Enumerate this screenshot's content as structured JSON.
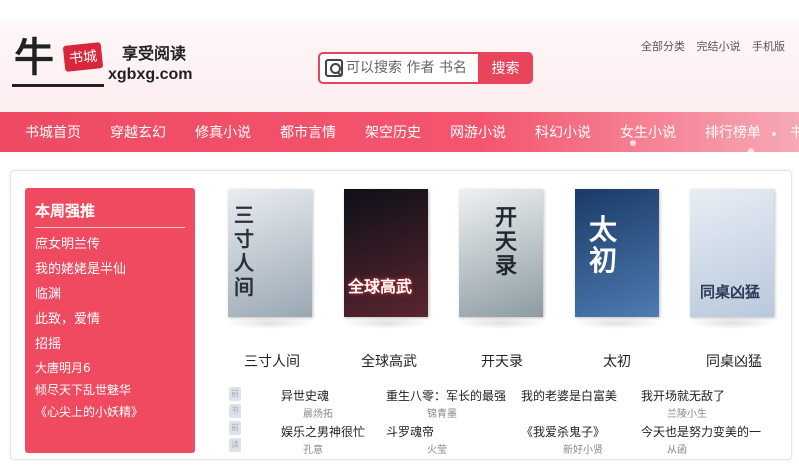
{
  "logo": {
    "char": "牛",
    "box": "书城",
    "slogan": "享受阅读",
    "domain": "xgbxg.com"
  },
  "search": {
    "placeholder": "可以搜索 作者 书名",
    "button": "搜索"
  },
  "toplinks": [
    "全部分类",
    "完结小说",
    "手机版"
  ],
  "nav": [
    "书城首页",
    "穿越玄幻",
    "修真小说",
    "都市言情",
    "架空历史",
    "网游小说",
    "科幻小说",
    "女生小说",
    "排行榜单",
    "书架"
  ],
  "rank": {
    "title": "本周强推",
    "items": [
      "庶女明兰传",
      "我的姥姥是半仙",
      "临渊",
      "此致，爱情",
      "招摇",
      "大唐明月6",
      "倾尽天下乱世魅华",
      "《心尖上的小妖精》"
    ]
  },
  "covers": [
    {
      "title": "三寸人间",
      "cover_text": "三寸人间",
      "colors": [
        "#e9edf1",
        "#9aa7b3"
      ]
    },
    {
      "title": "全球高武",
      "cover_text": "全球高武",
      "colors": [
        "#0d1018",
        "#5a2530"
      ]
    },
    {
      "title": "开天录",
      "cover_text": "开天录",
      "colors": [
        "#eef1f2",
        "#8d9ba1"
      ]
    },
    {
      "title": "太初",
      "cover_text": "太初",
      "colors": [
        "#1a3a66",
        "#4d7bb2"
      ]
    },
    {
      "title": "同桌凶猛",
      "cover_text": "同桌凶猛",
      "colors": [
        "#e8eef4",
        "#b8c8dc"
      ]
    }
  ],
  "tags": [
    "前",
    "书",
    "前",
    "读"
  ],
  "booklist": [
    {
      "title": "异世史魂",
      "author": "晨炀拓"
    },
    {
      "title": "重生八零：军长的最强",
      "author": "锦青墨"
    },
    {
      "title": "我的老婆是白富美",
      "author": ""
    },
    {
      "title": "我开场就无敌了",
      "author": "兰陵小生"
    },
    {
      "title": "娱乐之男神很忙",
      "author": "孔意"
    },
    {
      "title": "斗罗魂帝",
      "author": "火莹"
    },
    {
      "title": "《我爱杀鬼子》",
      "author": "新好小贤"
    },
    {
      "title": "今天也是努力变美的一",
      "author": "从函"
    }
  ]
}
